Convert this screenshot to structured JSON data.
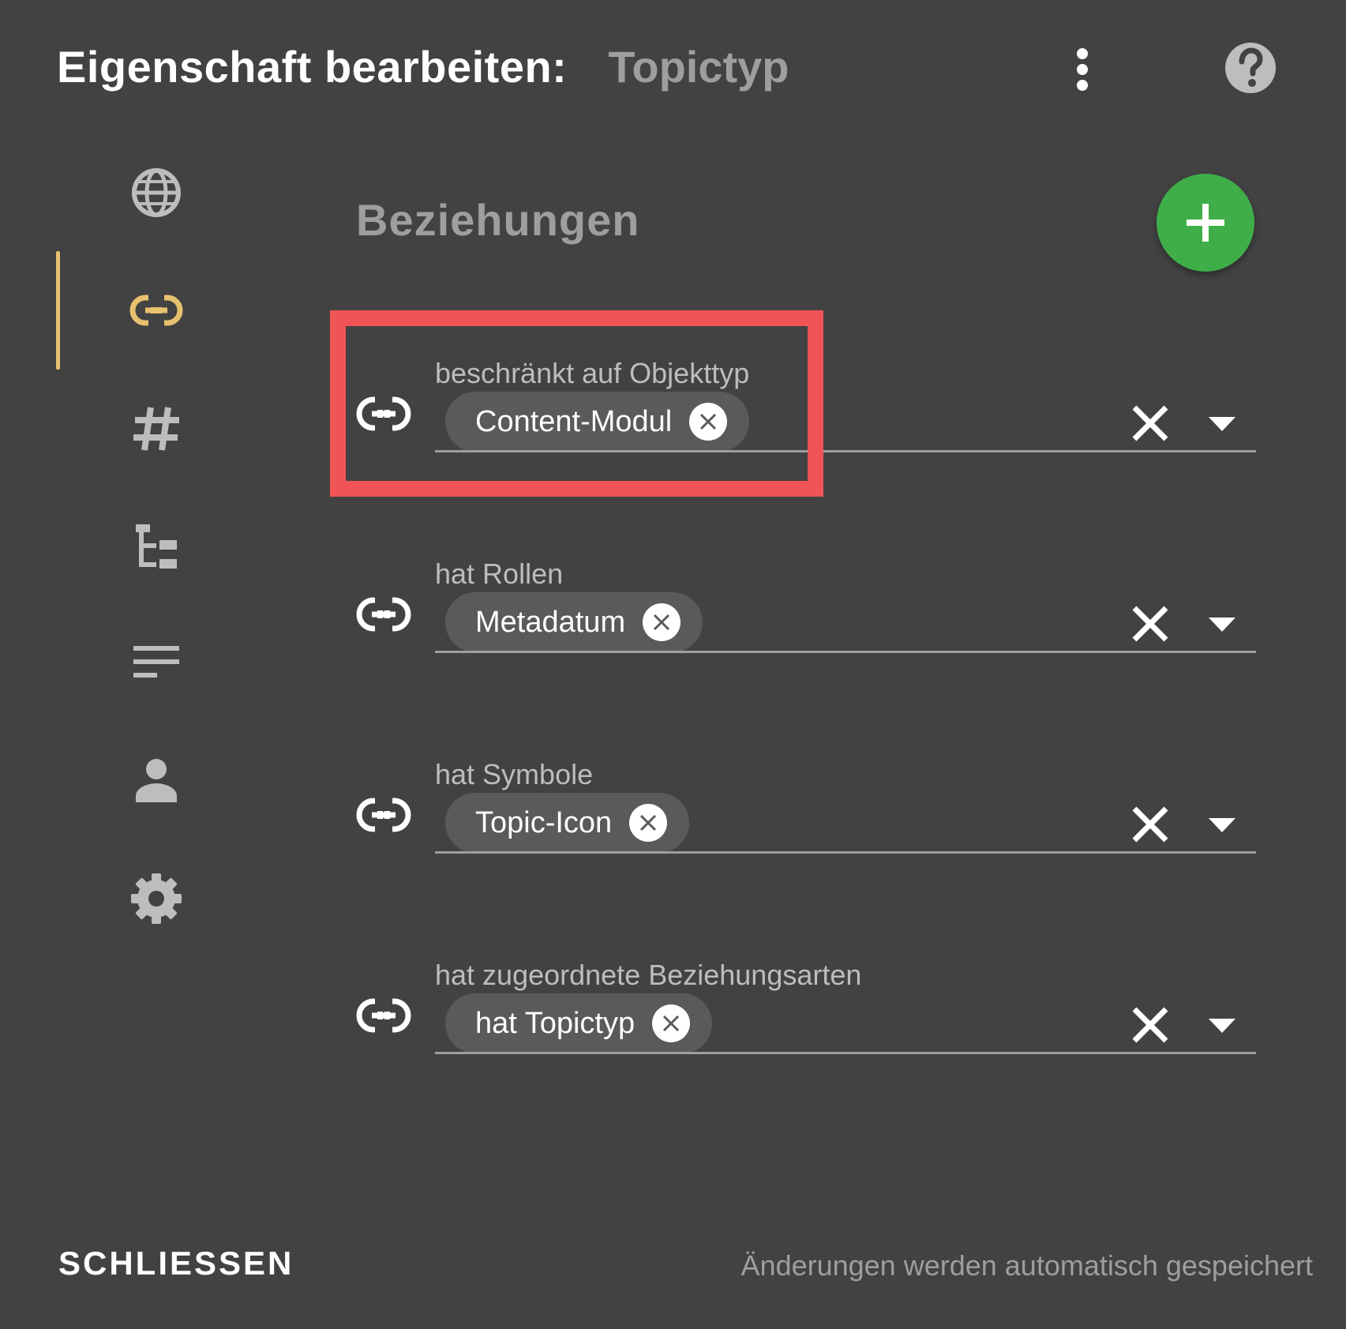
{
  "header": {
    "title": "Eigenschaft bearbeiten:",
    "subtitle": "Topictyp",
    "menu_icon": "more-vert-icon",
    "help_icon": "help-icon"
  },
  "side_nav": {
    "items": [
      {
        "icon": "globe-icon",
        "active": false
      },
      {
        "icon": "link-icon",
        "active": true
      },
      {
        "icon": "hash-icon",
        "active": false
      },
      {
        "icon": "tree-icon",
        "active": false
      },
      {
        "icon": "text-lines-icon",
        "active": false
      },
      {
        "icon": "person-icon",
        "active": false
      },
      {
        "icon": "gear-icon",
        "active": false
      }
    ],
    "active_color": "#e8c16f"
  },
  "section": {
    "title": "Beziehungen",
    "add_button_color": "#3fae49"
  },
  "relations": [
    {
      "label": "beschränkt auf Objekttyp",
      "chip": "Content-Modul"
    },
    {
      "label": "hat Rollen",
      "chip": "Metadatum"
    },
    {
      "label": "hat Symbole",
      "chip": "Topic-Icon"
    },
    {
      "label": "hat zugeordnete Beziehungsarten",
      "chip": "hat Topictyp"
    }
  ],
  "highlight_color": "#f15457",
  "footer": {
    "close_label": "SCHLIESSEN",
    "autosave_note": "Änderungen werden automatisch gespeichert"
  }
}
